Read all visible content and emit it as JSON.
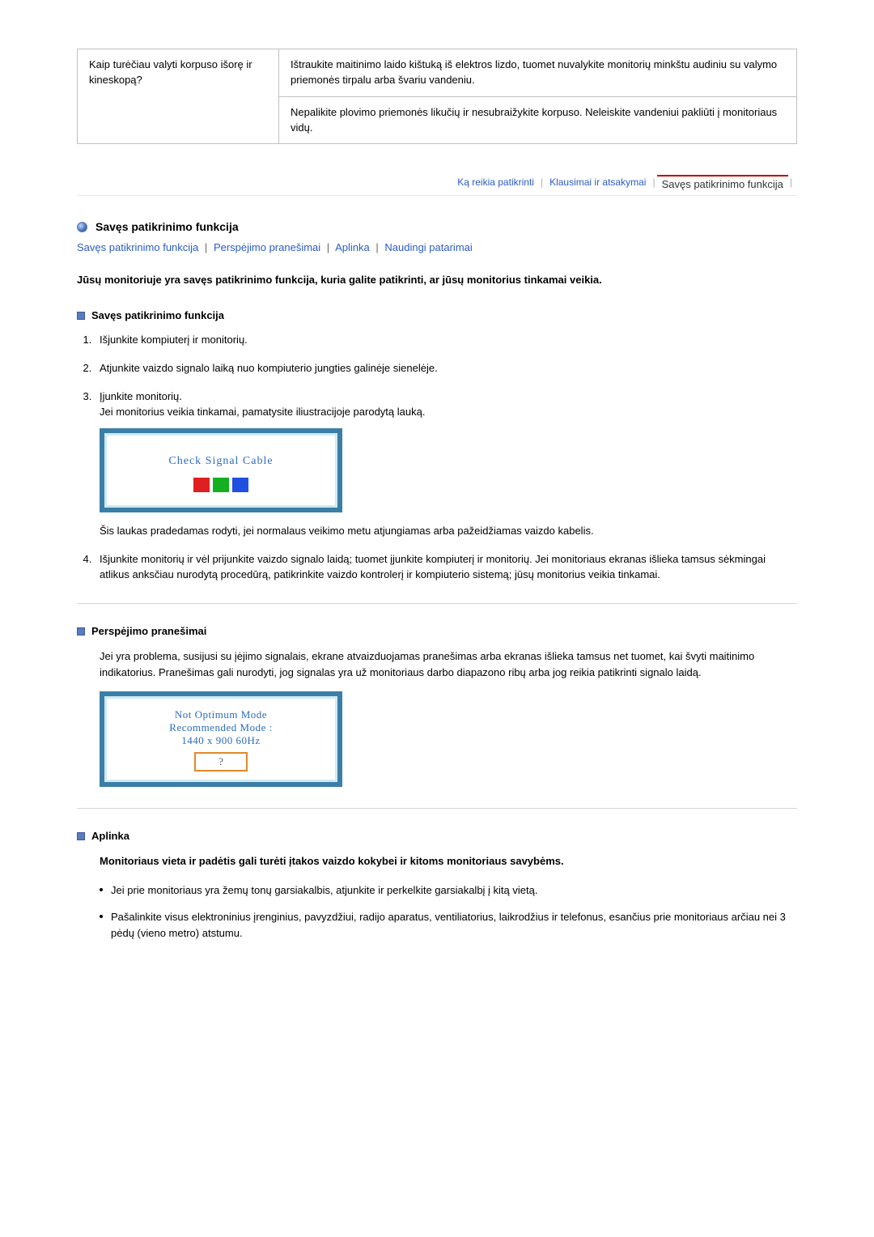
{
  "qa": {
    "question": "Kaip turėčiau valyti korpuso išorę ir kineskopą?",
    "answer_p1": "Ištraukite maitinimo laido kištuką iš elektros lizdo, tuomet nuvalykite monitorių minkštu audiniu su valymo priemonės tirpalu arba švariu vandeniu.",
    "answer_p2": "Nepalikite plovimo priemonės likučių ir nesubraižykite korpuso. Neleiskite vandeniui pakliūti į monitoriaus vidų."
  },
  "tabs": {
    "a": "Ką reikia patikrinti",
    "b": "Klausimai ir atsakymai",
    "c": "Savęs patikrinimo funkcija"
  },
  "section": {
    "title": "Savęs patikrinimo funkcija"
  },
  "links": {
    "a": "Savęs patikrinimo funkcija",
    "b": "Perspėjimo pranešimai",
    "c": "Aplinka",
    "d": "Naudingi patarimai"
  },
  "intro": "Jūsų monitoriuje yra savęs patikrinimo funkcija, kuria galite patikrinti, ar jūsų monitorius tinkamai veikia.",
  "selfcheck": {
    "title": "Savęs patikrinimo funkcija",
    "s1": "Išjunkite kompiuterį ir monitorių.",
    "s2": "Atjunkite vaizdo signalo laiką nuo kompiuterio jungties galinėje sienelėje.",
    "s3a": "Įjunkite monitorių.",
    "s3b": "Jei monitorius veikia tinkamai, pamatysite iliustracijoje parodytą lauką.",
    "illus_text": "Check Signal Cable",
    "after_illus": "Šis laukas pradedamas rodyti, jei normalaus veikimo metu atjungiamas arba pažeidžiamas vaizdo kabelis.",
    "s4": "Išjunkite monitorių ir vėl prijunkite vaizdo signalo laidą; tuomet įjunkite kompiuterį ir monitorių. Jei monitoriaus ekranas išlieka tamsus sėkmingai atlikus anksčiau nurodytą procedūrą, patikrinkite vaizdo kontrolerį ir kompiuterio sistemą; jūsų monitorius veikia tinkamai."
  },
  "warnings": {
    "title": "Perspėjimo pranešimai",
    "p": "Jei yra problema, susijusi su įėjimo signalais, ekrane atvaizduojamas pranešimas arba ekranas išlieka tamsus net tuomet, kai švyti maitinimo indikatorius. Pranešimas gali nurodyti, jog signalas yra už monitoriaus darbo diapazono ribų arba jog reikia patikrinti signalo laidą.",
    "illus_l1": "Not Optimum Mode",
    "illus_l2": "Recommended Mode :",
    "illus_l3": "1440 x 900 60Hz",
    "illus_btn": "?"
  },
  "env": {
    "title": "Aplinka",
    "lead": "Monitoriaus vieta ir padėtis gali turėti įtakos vaizdo kokybei ir kitoms monitoriaus savybėms.",
    "li1": "Jei prie monitoriaus yra žemų tonų garsiakalbis, atjunkite ir perkelkite garsiakalbį į kitą vietą.",
    "li2": "Pašalinkite visus elektroninius įrenginius, pavyzdžiui, radijo aparatus, ventiliatorius, laikrodžius ir telefonus, esančius prie monitoriaus arčiau nei 3 pėdų (vieno metro) atstumu."
  }
}
